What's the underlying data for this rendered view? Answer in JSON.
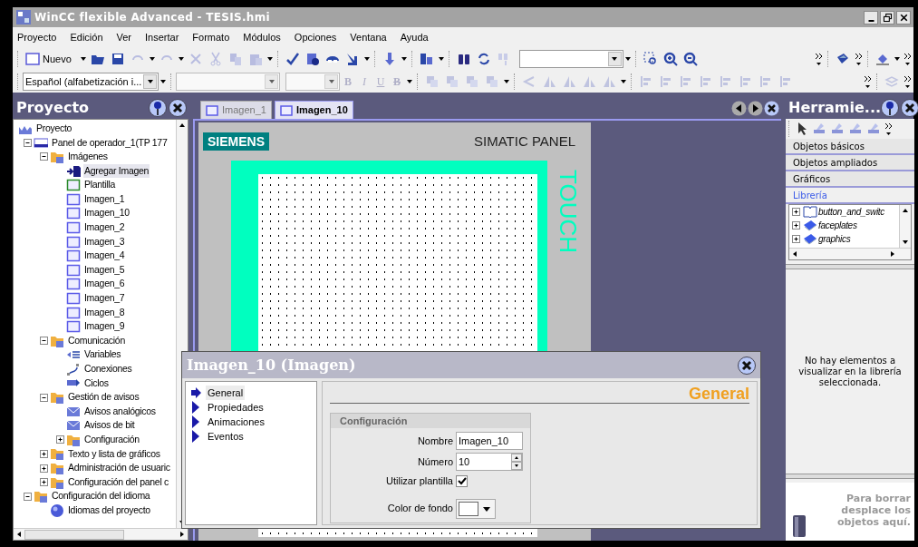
{
  "window": {
    "title": "WinCC flexible Advanced - TESIS.hmi"
  },
  "menu": [
    "Proyecto",
    "Edición",
    "Ver",
    "Insertar",
    "Formato",
    "Módulos",
    "Opciones",
    "Ventana",
    "Ayuda"
  ],
  "toolbar": {
    "new_button": "Nuevo",
    "language_select": "Español (alfabetización i...",
    "format_buttons": [
      {
        "label": "B",
        "kind": "bold",
        "disabled": true
      },
      {
        "label": "I",
        "kind": "italic",
        "disabled": true
      },
      {
        "label": "U",
        "kind": "underline",
        "disabled": true
      },
      {
        "label": "B",
        "kind": "strike",
        "disabled": true
      }
    ]
  },
  "project_panel": {
    "title": "Proyecto",
    "tree": [
      {
        "label": "Proyecto",
        "kind": "project",
        "selected": false,
        "children": [
          {
            "label": "Panel de operador_1(TP 177",
            "kind": "device",
            "selected": false,
            "expanded": true,
            "children": [
              {
                "label": "Imágenes",
                "kind": "folder",
                "selected": false,
                "expanded": true,
                "children": [
                  {
                    "label": "Agregar Imagen",
                    "kind": "add",
                    "selected": true
                  },
                  {
                    "label": "Plantilla",
                    "kind": "template",
                    "selected": false
                  },
                  {
                    "label": "Imagen_1",
                    "kind": "screen",
                    "selected": false
                  },
                  {
                    "label": "Imagen_10",
                    "kind": "screen",
                    "selected": false
                  },
                  {
                    "label": "Imagen_2",
                    "kind": "screen",
                    "selected": false
                  },
                  {
                    "label": "Imagen_3",
                    "kind": "screen",
                    "selected": false
                  },
                  {
                    "label": "Imagen_4",
                    "kind": "screen",
                    "selected": false
                  },
                  {
                    "label": "Imagen_5",
                    "kind": "screen",
                    "selected": false
                  },
                  {
                    "label": "Imagen_6",
                    "kind": "screen",
                    "selected": false
                  },
                  {
                    "label": "Imagen_7",
                    "kind": "screen",
                    "selected": false
                  },
                  {
                    "label": "Imagen_8",
                    "kind": "screen",
                    "selected": false
                  },
                  {
                    "label": "Imagen_9",
                    "kind": "screen",
                    "selected": false
                  }
                ]
              },
              {
                "label": "Comunicación",
                "kind": "folder",
                "selected": false,
                "expanded": true,
                "children": [
                  {
                    "label": "Variables",
                    "kind": "tag",
                    "selected": false
                  },
                  {
                    "label": "Conexiones",
                    "kind": "connection",
                    "selected": false
                  },
                  {
                    "label": "Ciclos",
                    "kind": "cycle",
                    "selected": false
                  }
                ]
              },
              {
                "label": "Gestión de avisos",
                "kind": "folder",
                "selected": false,
                "expanded": true,
                "children": [
                  {
                    "label": "Avisos analógicos",
                    "kind": "alarm",
                    "selected": false
                  },
                  {
                    "label": "Avisos de bit",
                    "kind": "alarm",
                    "selected": false
                  },
                  {
                    "label": "Configuración",
                    "kind": "folder",
                    "selected": false,
                    "expanded": false
                  }
                ]
              },
              {
                "label": "Texto y lista de gráficos",
                "kind": "folder",
                "selected": false,
                "expanded": false
              },
              {
                "label": "Administración de usuaric",
                "kind": "folder",
                "selected": false,
                "expanded": false
              },
              {
                "label": "Configuración del panel c",
                "kind": "folder",
                "selected": false,
                "expanded": false
              }
            ]
          },
          {
            "label": "Configuración del idioma",
            "kind": "folder",
            "selected": false,
            "expanded": true,
            "children": [
              {
                "label": "Idiomas del proyecto",
                "kind": "globe",
                "selected": false
              }
            ]
          }
        ]
      }
    ]
  },
  "editor": {
    "tabs": [
      {
        "label": "Imagen_1",
        "selected": false
      },
      {
        "label": "Imagen_10",
        "selected": true
      }
    ],
    "panel": {
      "brand": "SIEMENS",
      "model": "SIMATIC PANEL",
      "touch_label": "TOUCH"
    }
  },
  "properties": {
    "title": "Imagen_10 (Imagen)",
    "nav": [
      {
        "label": "General",
        "selected": true
      },
      {
        "label": "Propiedades",
        "selected": false
      },
      {
        "label": "Animaciones",
        "selected": false
      },
      {
        "label": "Eventos",
        "selected": false
      }
    ],
    "heading": "General",
    "group": "Configuración",
    "fields": [
      {
        "kind": "text",
        "label": "Nombre",
        "value": "Imagen_10"
      },
      {
        "kind": "spin",
        "label": "Número",
        "value": "10"
      },
      {
        "kind": "checkbox",
        "label": "Utilizar plantilla",
        "checked": true
      },
      {
        "kind": "color",
        "label": "Color de fondo",
        "color": "#ffffff"
      }
    ]
  },
  "tools_panel": {
    "title": "Herramie...",
    "sections": [
      {
        "label": "Objetos básicos",
        "selected": false
      },
      {
        "label": "Objetos ampliados",
        "selected": false
      },
      {
        "label": "Gráficos",
        "selected": false
      },
      {
        "label": "Librería",
        "selected": true
      }
    ],
    "library": [
      {
        "label": "button_and_switc",
        "kind": "open-book"
      },
      {
        "label": "faceplates",
        "kind": "book"
      },
      {
        "label": "graphics",
        "kind": "book"
      }
    ],
    "empty_message": "No hay elementos a visualizar en la librería seleccionada.",
    "trash_hint": "Para borrar desplace los objetos aquí."
  }
}
